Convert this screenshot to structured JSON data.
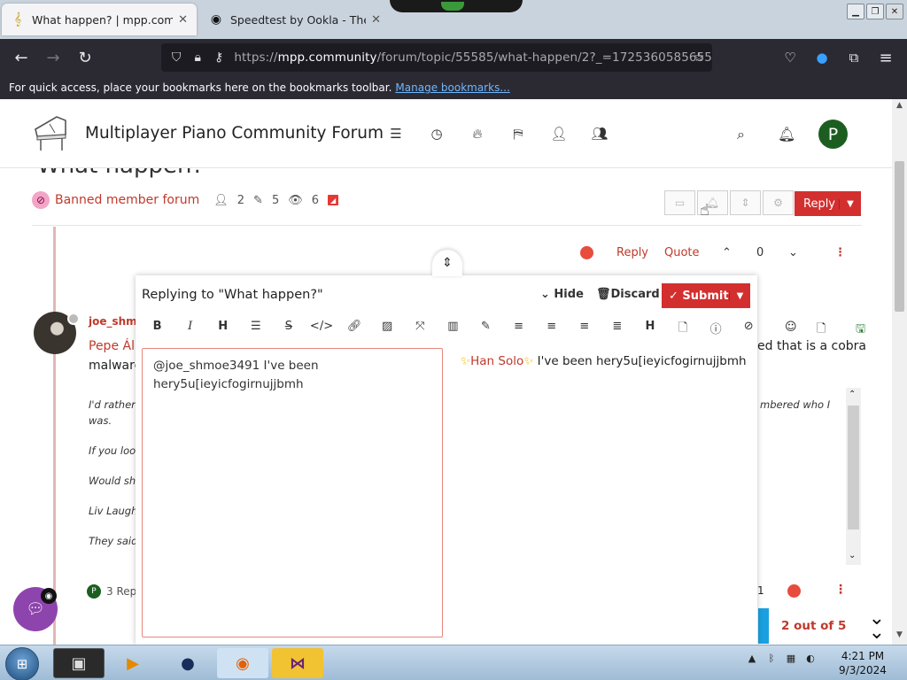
{
  "browser": {
    "tabs": [
      {
        "title": "What happen? | mpp.communi",
        "icon": "treble-clef"
      },
      {
        "title": "Speedtest by Ookla - The Glob",
        "icon": "speedometer"
      }
    ],
    "url_prefix": "https://",
    "url_host": "mpp.community",
    "url_path": "/forum/topic/55585/what-happen/2?_=1725360585655",
    "bookmarks_hint": "For quick access, place your bookmarks here on the bookmarks toolbar.",
    "bookmarks_link": "Manage bookmarks..."
  },
  "site": {
    "title": "Multiplayer Piano Community Forum",
    "avatar_letter": "P"
  },
  "topic": {
    "title": "What happen?",
    "category": "Banned member forum",
    "stats": {
      "posters": "2",
      "posts": "5",
      "views": "6"
    },
    "reply_label": "Reply"
  },
  "post": {
    "reply": "Reply",
    "quote": "Quote",
    "votes": "0",
    "username": "joe_shm",
    "line1_left": "Pepe Ál",
    "line1_right": "ed that is a cobra",
    "line2_left": "malware",
    "italics": [
      "I'd rather",
      "was.",
      "If you loo",
      "Would sh",
      "Liv Laugh",
      "They said"
    ],
    "italic_right": "mbered who I",
    "replies": "3 Rep",
    "votes_right": "1",
    "pager": "2 out of 5"
  },
  "composer": {
    "heading": "Replying to \"What happen?\"",
    "hide": "Hide",
    "discard": "Discard",
    "submit": "Submit",
    "editor_text": "@joe_shmoe3491 I've been\nhery5u[ieyicfogirnujjbmh",
    "preview_mention": "Han Solo",
    "preview_text": " I've been hery5u[ieyicfogirnujjbmh"
  },
  "taskbar": {
    "time": "4:21 PM",
    "date": "9/3/2024"
  },
  "colors": {
    "accent_red": "#d32f2f",
    "category_red": "#c0392b",
    "browser_dark": "#2b2a33",
    "chat_purple": "#8e44ad",
    "pager_blue": "#1aa0e0"
  }
}
